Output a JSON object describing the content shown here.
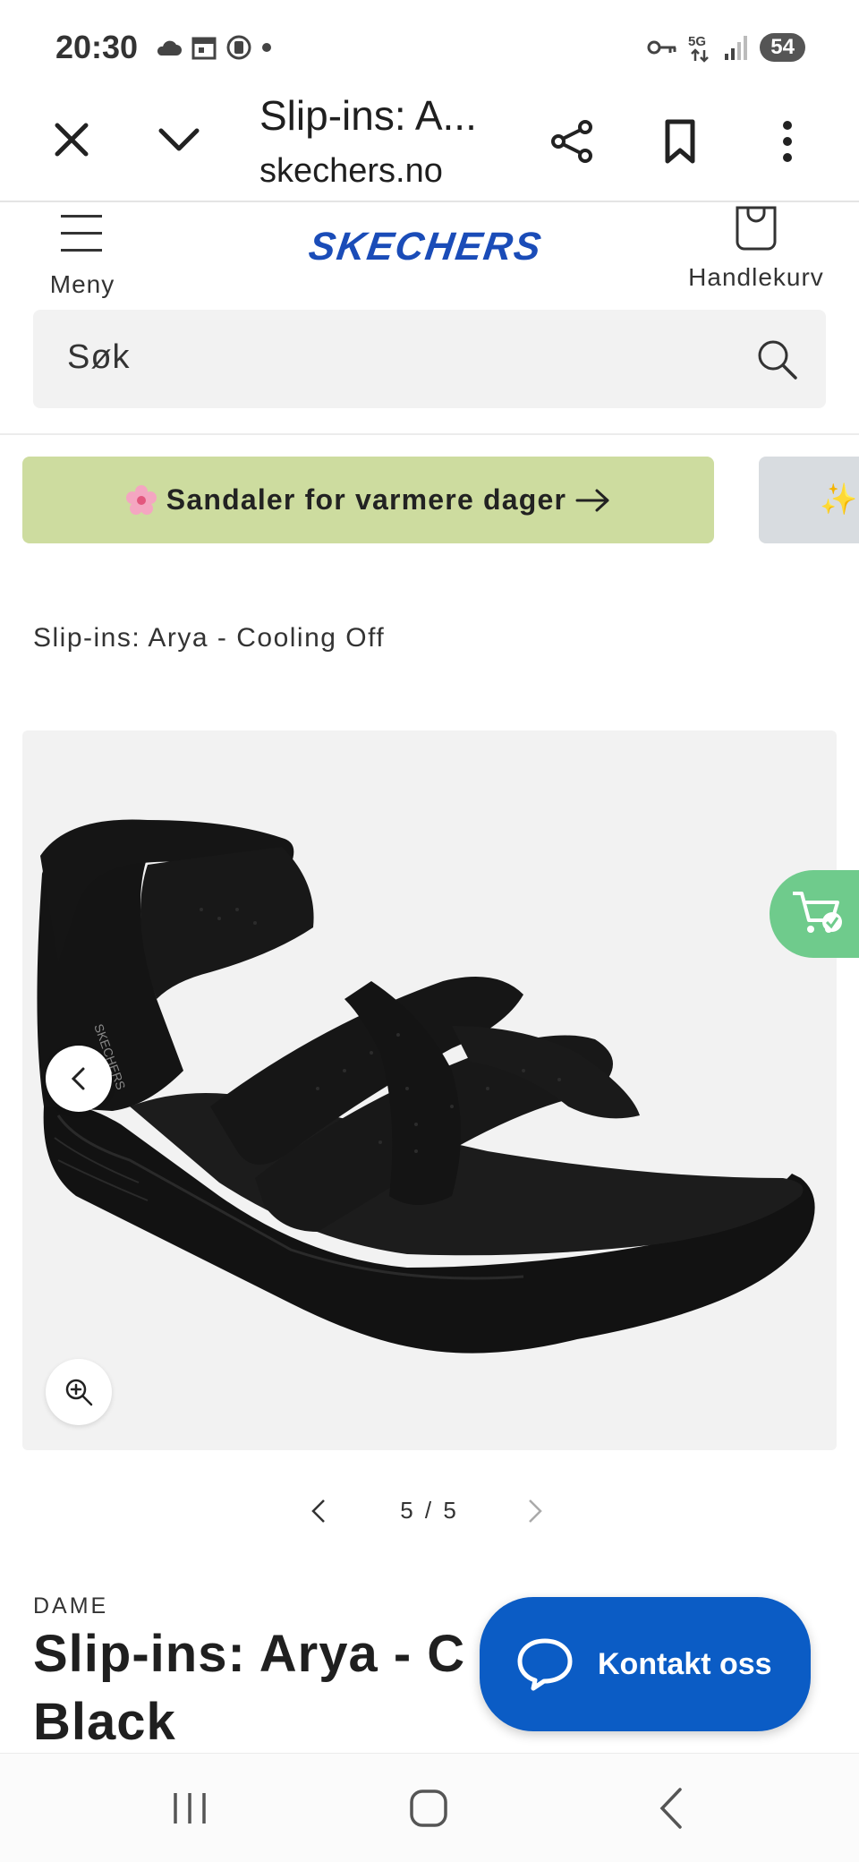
{
  "status_bar": {
    "time": "20:30",
    "battery": "54",
    "left_icons": [
      "cloud-icon",
      "calendar-icon",
      "record-icon",
      "dot-icon"
    ],
    "right_icons": [
      "key-icon",
      "5g-icon",
      "signal-icon"
    ]
  },
  "browser": {
    "tab_title": "Slip-ins: A...",
    "url": "skechers.no"
  },
  "header": {
    "menu_label": "Meny",
    "logo_text": "SKECHERS",
    "cart_label": "Handlekurv",
    "search_placeholder": "Søk"
  },
  "promo": {
    "main_text": "Sandaler for varmere dager",
    "main_bg": "#cddc9f",
    "secondary_bg": "#d8dce0"
  },
  "breadcrumb_title": "Slip-ins: Arya - Cooling Off",
  "gallery": {
    "current": 5,
    "total": 5,
    "counter_text": "5 / 5"
  },
  "product": {
    "category": "DAME",
    "title_line1": "Slip-ins: Arya - C",
    "title_line2": "Black"
  },
  "contact": {
    "label": "Kontakt oss",
    "bg": "#0b5cc5"
  },
  "colors": {
    "logo_blue": "#1a4cb8",
    "cart_float_green": "#6fcb8c"
  }
}
